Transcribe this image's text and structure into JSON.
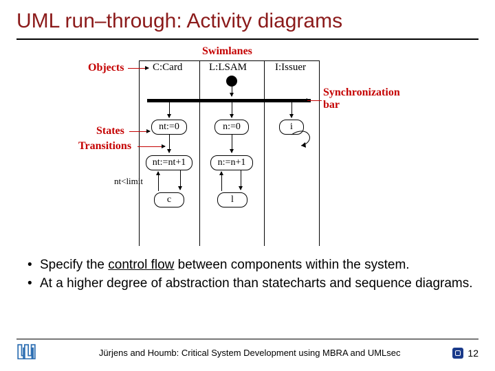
{
  "title": "UML run–through: Activity diagrams",
  "diagram": {
    "swimlanes_label": "Swimlanes",
    "objects_label": "Objects",
    "states_label": "States",
    "transitions_label": "Transitions",
    "syncbar_label": "Synchronization bar",
    "lanes": {
      "card": "C:Card",
      "lsam": "L:LSAM",
      "issuer": "I:Issuer"
    },
    "states": {
      "nt0": "nt:=0",
      "n0": "n:=0",
      "i": "i",
      "nt1": "nt:=nt+1",
      "n1": "n:=n+1",
      "c": "c",
      "l": "l"
    },
    "guard": "nt<limit"
  },
  "bullets": [
    {
      "pre": "Specify the ",
      "u": "control flow",
      "post": " between components within the system."
    },
    {
      "pre": "At a higher degree of abstraction than statecharts and sequence diagrams.",
      "u": "",
      "post": ""
    }
  ],
  "footer": {
    "text": "Jürjens and Houmb: Critical System Development using MBRA and UMLsec",
    "page": "12"
  }
}
